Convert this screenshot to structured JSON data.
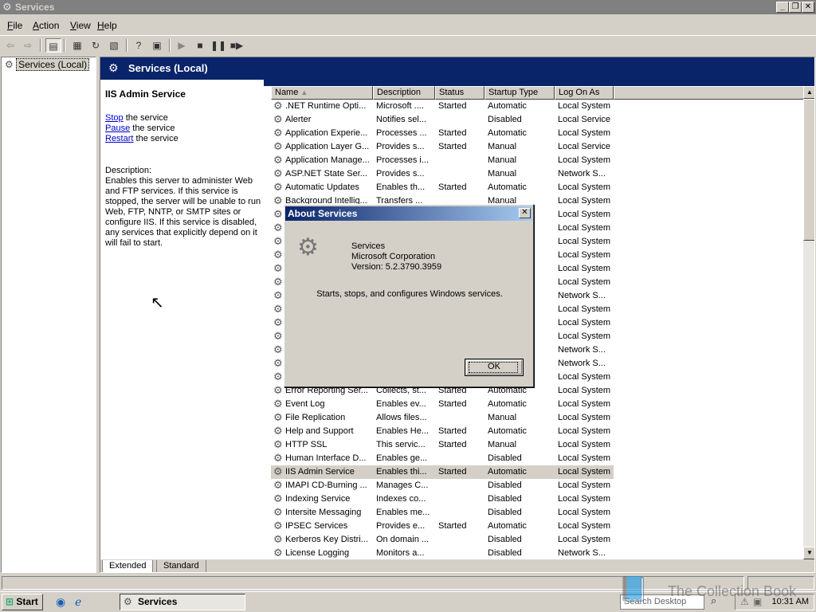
{
  "window": {
    "title": "Services"
  },
  "menu": [
    {
      "label": "File",
      "u": "F",
      "rest": "ile"
    },
    {
      "label": "Action",
      "u": "A",
      "rest": "ction"
    },
    {
      "label": "View",
      "u": "V",
      "rest": "iew"
    },
    {
      "label": "Help",
      "u": "H",
      "rest": "elp"
    }
  ],
  "tree": {
    "root": "Services (Local)"
  },
  "header": {
    "title": "Services (Local)"
  },
  "details": {
    "service_name": "IIS Admin Service",
    "actions": [
      {
        "link": "Stop",
        "rest": " the service"
      },
      {
        "link": "Pause",
        "rest": " the service"
      },
      {
        "link": "Restart",
        "rest": " the service"
      }
    ],
    "description_label": "Description:",
    "description": "Enables this server to administer Web and FTP services. If this service is stopped, the server will be unable to run Web, FTP, NNTP, or SMTP sites or configure IIS. If this service is disabled, any services that explicitly depend on it will fail to start."
  },
  "list": {
    "columns": [
      "Name",
      "Description",
      "Status",
      "Startup Type",
      "Log On As"
    ],
    "rows": [
      {
        "name": ".NET Runtime Opti...",
        "desc": "Microsoft ....",
        "status": "Started",
        "startup": "Automatic",
        "logon": "Local System"
      },
      {
        "name": "Alerter",
        "desc": "Notifies sel...",
        "status": "",
        "startup": "Disabled",
        "logon": "Local Service"
      },
      {
        "name": "Application Experie...",
        "desc": "Processes ...",
        "status": "Started",
        "startup": "Automatic",
        "logon": "Local System"
      },
      {
        "name": "Application Layer G...",
        "desc": "Provides s...",
        "status": "Started",
        "startup": "Manual",
        "logon": "Local Service"
      },
      {
        "name": "Application Manage...",
        "desc": "Processes i...",
        "status": "",
        "startup": "Manual",
        "logon": "Local System"
      },
      {
        "name": "ASP.NET State Ser...",
        "desc": "Provides s...",
        "status": "",
        "startup": "Manual",
        "logon": "Network S..."
      },
      {
        "name": "Automatic Updates",
        "desc": "Enables th...",
        "status": "Started",
        "startup": "Automatic",
        "logon": "Local System"
      },
      {
        "name": "Background Intellig...",
        "desc": "Transfers ...",
        "status": "",
        "startup": "Manual",
        "logon": "Local System"
      },
      {
        "name": "",
        "desc": "",
        "status": "",
        "startup": "",
        "logon": "Local System"
      },
      {
        "name": "",
        "desc": "",
        "status": "",
        "startup": "",
        "logon": "Local System"
      },
      {
        "name": "",
        "desc": "",
        "status": "",
        "startup": "",
        "logon": "Local System"
      },
      {
        "name": "",
        "desc": "",
        "status": "",
        "startup": "",
        "logon": "Local System"
      },
      {
        "name": "",
        "desc": "",
        "status": "",
        "startup": "",
        "logon": "Local System"
      },
      {
        "name": "",
        "desc": "",
        "status": "",
        "startup": "",
        "logon": "Local System"
      },
      {
        "name": "",
        "desc": "",
        "status": "",
        "startup": "",
        "logon": "Network S..."
      },
      {
        "name": "",
        "desc": "",
        "status": "",
        "startup": "",
        "logon": "Local System"
      },
      {
        "name": "",
        "desc": "",
        "status": "",
        "startup": "",
        "logon": "Local System"
      },
      {
        "name": "",
        "desc": "",
        "status": "",
        "startup": "",
        "logon": "Local System"
      },
      {
        "name": "",
        "desc": "",
        "status": "",
        "startup": "",
        "logon": "Network S..."
      },
      {
        "name": "",
        "desc": "",
        "status": "",
        "startup": "",
        "logon": "Network S..."
      },
      {
        "name": "",
        "desc": "",
        "status": "",
        "startup": "",
        "logon": "Local System"
      },
      {
        "name": "Error Reporting Ser...",
        "desc": "Collects, st...",
        "status": "Started",
        "startup": "Automatic",
        "logon": "Local System"
      },
      {
        "name": "Event Log",
        "desc": "Enables ev...",
        "status": "Started",
        "startup": "Automatic",
        "logon": "Local System"
      },
      {
        "name": "File Replication",
        "desc": "Allows files...",
        "status": "",
        "startup": "Manual",
        "logon": "Local System"
      },
      {
        "name": "Help and Support",
        "desc": "Enables He...",
        "status": "Started",
        "startup": "Automatic",
        "logon": "Local System"
      },
      {
        "name": "HTTP SSL",
        "desc": "This servic...",
        "status": "Started",
        "startup": "Manual",
        "logon": "Local System"
      },
      {
        "name": "Human Interface D...",
        "desc": "Enables ge...",
        "status": "",
        "startup": "Disabled",
        "logon": "Local System"
      },
      {
        "name": "IIS Admin Service",
        "desc": "Enables thi...",
        "status": "Started",
        "startup": "Automatic",
        "logon": "Local System",
        "selected": true
      },
      {
        "name": "IMAPI CD-Burning ...",
        "desc": "Manages C...",
        "status": "",
        "startup": "Disabled",
        "logon": "Local System"
      },
      {
        "name": "Indexing Service",
        "desc": "Indexes co...",
        "status": "",
        "startup": "Disabled",
        "logon": "Local System"
      },
      {
        "name": "Intersite Messaging",
        "desc": "Enables me...",
        "status": "",
        "startup": "Disabled",
        "logon": "Local System"
      },
      {
        "name": "IPSEC Services",
        "desc": "Provides e...",
        "status": "Started",
        "startup": "Automatic",
        "logon": "Local System"
      },
      {
        "name": "Kerberos Key Distri...",
        "desc": "On domain ...",
        "status": "",
        "startup": "Disabled",
        "logon": "Local System"
      },
      {
        "name": "License Logging",
        "desc": "Monitors a...",
        "status": "",
        "startup": "Disabled",
        "logon": "Network S..."
      }
    ]
  },
  "tabs": [
    "Extended",
    "Standard"
  ],
  "dialog": {
    "title": "About Services",
    "product": "Services",
    "company": "Microsoft Corporation",
    "version": "Version: 5.2.3790.3959",
    "description": "Starts, stops, and configures Windows services.",
    "ok": "OK"
  },
  "taskbar": {
    "start": "Start",
    "task": "Services",
    "search_placeholder": "Search Desktop",
    "clock": "10:31 AM"
  },
  "watermark": "The Collection Book"
}
